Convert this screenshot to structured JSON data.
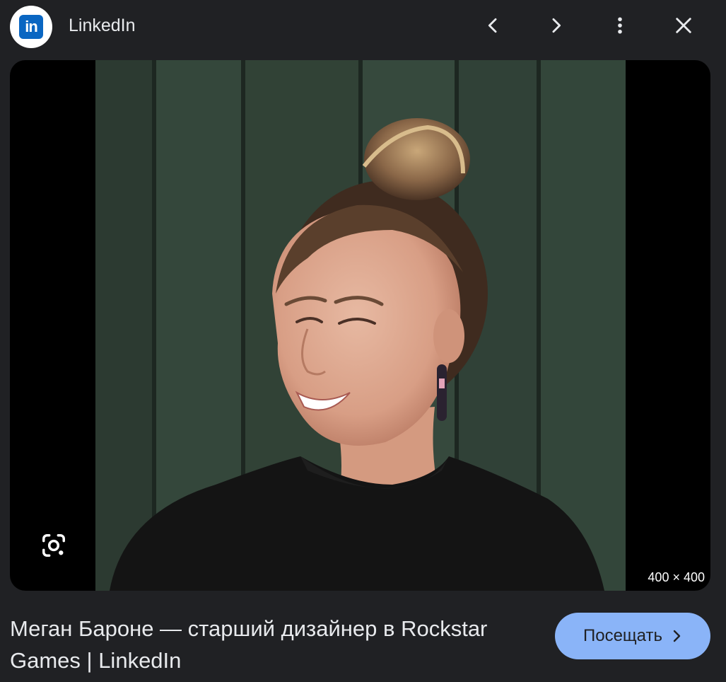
{
  "header": {
    "source_name": "LinkedIn",
    "source_logo_text": "in",
    "source_logo_icon": "linkedin-logo",
    "prev_icon": "chevron-left-icon",
    "next_icon": "chevron-right-icon",
    "more_icon": "more-vert-icon",
    "close_icon": "close-icon"
  },
  "image": {
    "dimensions": "400 × 400",
    "lens_icon": "google-lens-icon"
  },
  "result": {
    "title": "Меган Бароне — старший дизайнер в Rockstar Games | LinkedIn",
    "visit_label": "Посещать"
  },
  "colors": {
    "background": "#202124",
    "accent": "#8ab4f8",
    "linkedin_blue": "#0a66c2"
  }
}
